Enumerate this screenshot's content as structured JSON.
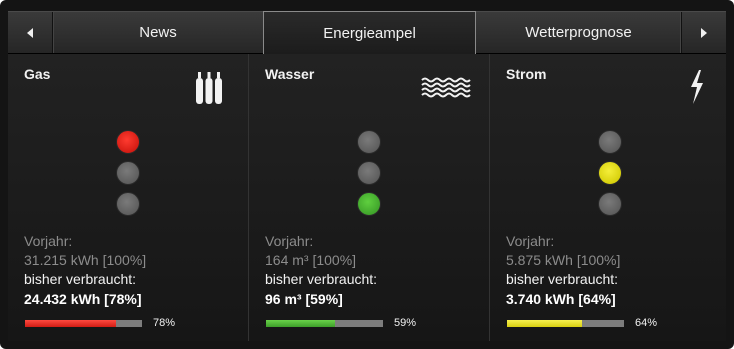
{
  "tabs": {
    "prev_icon": "triangle-left-icon",
    "next_icon": "triangle-right-icon",
    "items": [
      {
        "label": "News",
        "active": false
      },
      {
        "label": "Energieampel",
        "active": true
      },
      {
        "label": "Wetterprognose",
        "active": false
      }
    ]
  },
  "panels": [
    {
      "title": "Gas",
      "icon": "gas-cylinders-icon",
      "light": "red",
      "prev_label": "Vorjahr:",
      "prev_value": "31.215 kWh [100%]",
      "cur_label": "bisher verbraucht:",
      "cur_value": "24.432 kWh [78%]",
      "percent": 78,
      "percent_text": "78%",
      "bar_color": "#e8231b"
    },
    {
      "title": "Wasser",
      "icon": "water-waves-icon",
      "light": "green",
      "prev_label": "Vorjahr:",
      "prev_value": "164 m³ [100%]",
      "cur_label": "bisher verbraucht:",
      "cur_value": "96 m³ [59%]",
      "percent": 59,
      "percent_text": "59%",
      "bar_color": "#4fb534"
    },
    {
      "title": "Strom",
      "icon": "lightning-bolt-icon",
      "light": "yellow",
      "prev_label": "Vorjahr:",
      "prev_value": "5.875 kWh [100%]",
      "cur_label": "bisher verbraucht:",
      "cur_value": "3.740 kWh [64%]",
      "percent": 64,
      "percent_text": "64%",
      "bar_color": "#e6df20"
    }
  ]
}
